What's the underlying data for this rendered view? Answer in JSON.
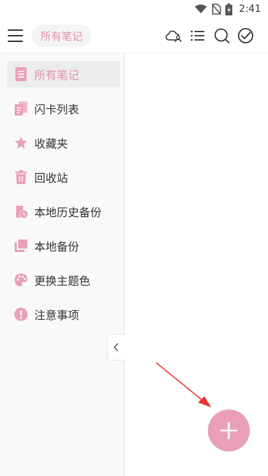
{
  "status_bar": {
    "time": "2:41",
    "icons": [
      "wifi-icon",
      "no-sim-icon",
      "battery-charging-icon"
    ]
  },
  "app_bar": {
    "title": "所有笔记",
    "icons": [
      "menu-icon",
      "cloud-user-icon",
      "list-icon",
      "search-icon",
      "check-circle-icon"
    ]
  },
  "sidebar": {
    "items": [
      {
        "label": "所有笔记",
        "icon": "note-icon",
        "active": true
      },
      {
        "label": "闪卡列表",
        "icon": "flashcard-icon",
        "active": false
      },
      {
        "label": "收藏夹",
        "icon": "star-icon",
        "active": false
      },
      {
        "label": "回收站",
        "icon": "trash-icon",
        "active": false
      },
      {
        "label": "本地历史备份",
        "icon": "history-backup-icon",
        "active": false
      },
      {
        "label": "本地备份",
        "icon": "backup-icon",
        "active": false
      },
      {
        "label": "更换主题色",
        "icon": "palette-icon",
        "active": false
      },
      {
        "label": "注意事项",
        "icon": "warning-icon",
        "active": false
      }
    ],
    "collapse_icon": "chevron-left-icon"
  },
  "fab": {
    "icon": "plus-icon"
  },
  "colors": {
    "accent": "#e48fac",
    "icon_pink": "#e99fba",
    "fab": "#e99fba",
    "annotation_arrow": "#e53935",
    "sidebar_bg": "#f9f9f9",
    "active_bg": "#ececec"
  }
}
